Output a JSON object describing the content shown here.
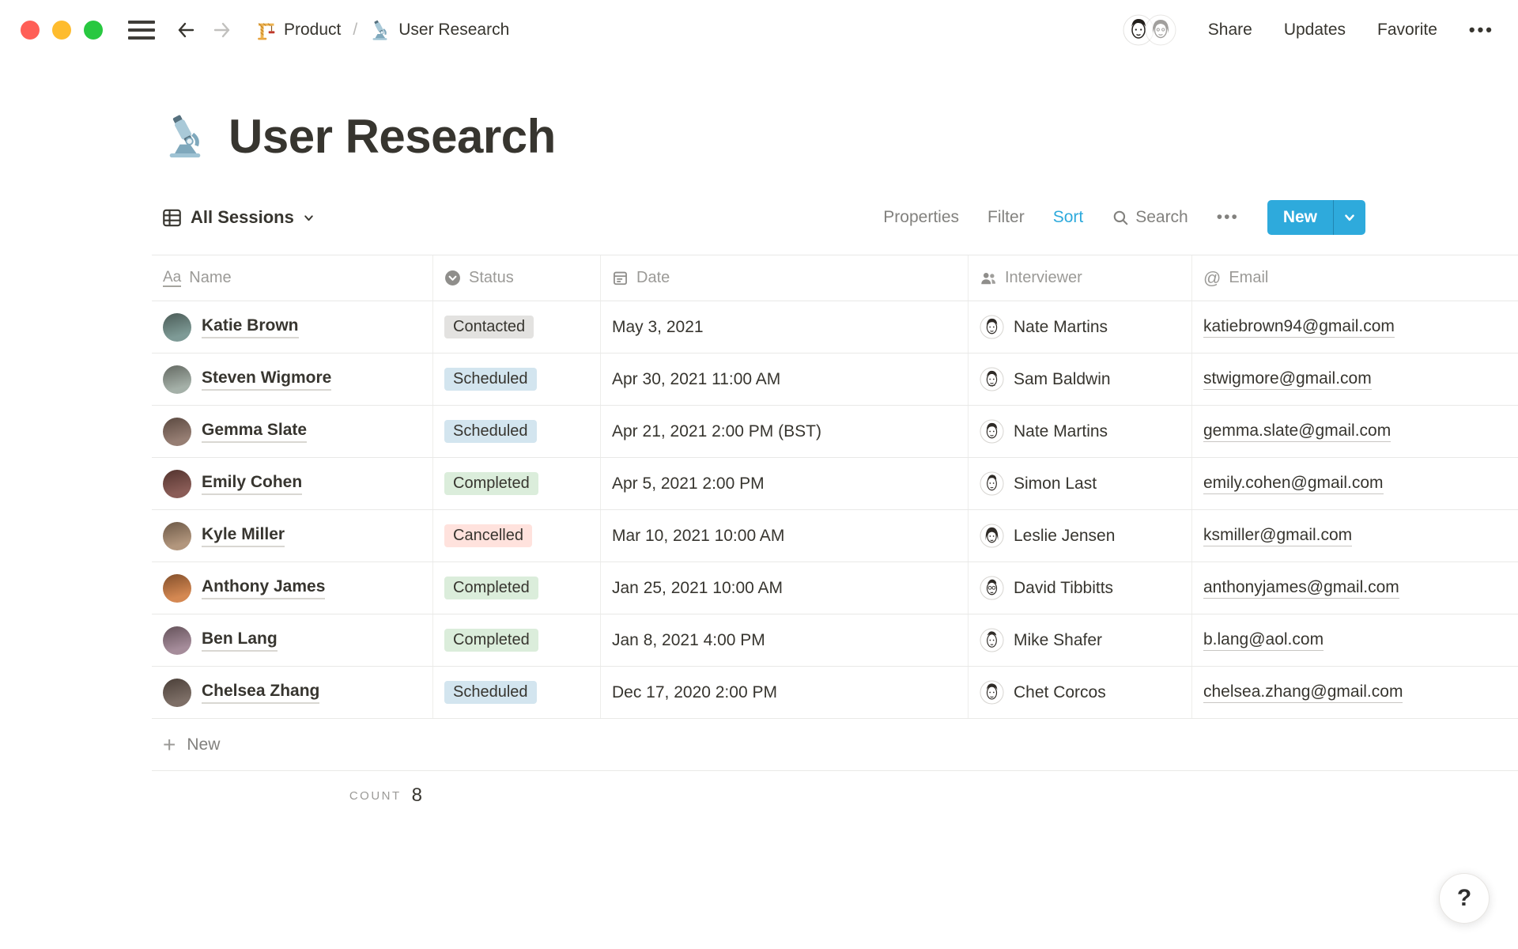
{
  "topbar": {
    "breadcrumb": {
      "product_icon": "🏗️",
      "product_label": "Product",
      "separator": "/",
      "page_icon": "🔬",
      "page_label": "User Research"
    },
    "actions": {
      "share": "Share",
      "updates": "Updates",
      "favorite": "Favorite",
      "more": "•••"
    }
  },
  "page": {
    "icon": "🔬",
    "title": "User Research"
  },
  "view_bar": {
    "view_name": "All Sessions",
    "properties": "Properties",
    "filter": "Filter",
    "sort": "Sort",
    "search": "Search",
    "more": "•••",
    "new_label": "New"
  },
  "table": {
    "columns": [
      {
        "icon": "text",
        "label": "Name"
      },
      {
        "icon": "select",
        "label": "Status"
      },
      {
        "icon": "calendar",
        "label": "Date"
      },
      {
        "icon": "person",
        "label": "Interviewer"
      },
      {
        "icon": "at",
        "label": "Email"
      }
    ],
    "rows": [
      {
        "name": "Katie Brown",
        "avatar_color": "#6f8f8a",
        "status": "Contacted",
        "status_style": "gray",
        "date": "May 3, 2021",
        "interviewer": "Nate Martins",
        "email": "katiebrown94@gmail.com"
      },
      {
        "name": "Steven Wigmore",
        "avatar_color": "#9aa79e",
        "status": "Scheduled",
        "status_style": "blue",
        "date": "Apr 30, 2021 11:00 AM",
        "interviewer": "Sam Baldwin",
        "email": "stwigmore@gmail.com"
      },
      {
        "name": "Gemma Slate",
        "avatar_color": "#8a6f63",
        "status": "Scheduled",
        "status_style": "blue",
        "date": "Apr 21, 2021 2:00 PM (BST)",
        "interviewer": "Nate Martins",
        "email": "gemma.slate@gmail.com"
      },
      {
        "name": "Emily Cohen",
        "avatar_color": "#7d4a44",
        "status": "Completed",
        "status_style": "green",
        "date": "Apr 5, 2021 2:00 PM",
        "interviewer": "Simon Last",
        "email": "emily.cohen@gmail.com"
      },
      {
        "name": "Kyle Miller",
        "avatar_color": "#a98a6e",
        "status": "Cancelled",
        "status_style": "red",
        "date": "Mar 10, 2021 10:00 AM",
        "interviewer": "Leslie Jensen",
        "email": "ksmiller@gmail.com"
      },
      {
        "name": "Anthony James",
        "avatar_color": "#cf7a3e",
        "status": "Completed",
        "status_style": "green",
        "date": "Jan 25, 2021 10:00 AM",
        "interviewer": "David Tibbitts",
        "email": "anthonyjames@gmail.com"
      },
      {
        "name": "Ben Lang",
        "avatar_color": "#9b7f8f",
        "status": "Completed",
        "status_style": "green",
        "date": "Jan 8, 2021 4:00 PM",
        "interviewer": "Mike Shafer",
        "email": "b.lang@aol.com"
      },
      {
        "name": "Chelsea Zhang",
        "avatar_color": "#6e5e55",
        "status": "Scheduled",
        "status_style": "blue",
        "date": "Dec 17, 2020 2:00 PM",
        "interviewer": "Chet Corcos",
        "email": "chelsea.zhang@gmail.com"
      }
    ],
    "new_row_label": "New",
    "summary_label": "COUNT",
    "summary_value": "8"
  },
  "help_label": "?",
  "colors": {
    "accent_blue": "#2eaadc",
    "badge_gray": "#e3e2e0",
    "badge_blue": "#d3e5ef",
    "badge_green": "#dbeddb",
    "badge_red": "#ffe2dd",
    "text_dark": "#37352f",
    "text_gray": "#9b9a97"
  }
}
